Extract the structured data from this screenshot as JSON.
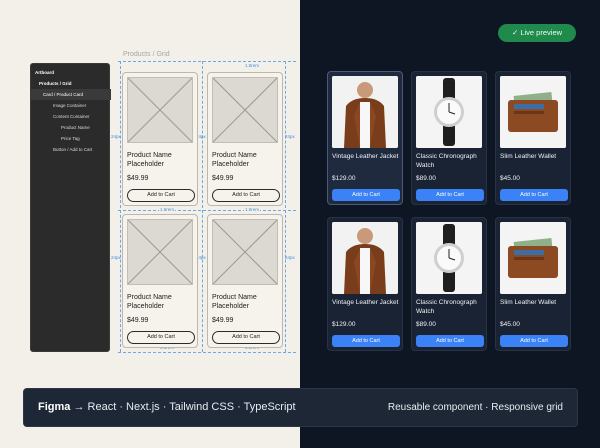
{
  "layers": {
    "items": [
      {
        "label": "Artboard",
        "bold": true,
        "indent": 0
      },
      {
        "label": "Products / Grid",
        "bold": true,
        "indent": 4
      },
      {
        "label": "Card / Product Card",
        "selected": true,
        "indent": 8
      },
      {
        "label": "Image Container",
        "indent": 22
      },
      {
        "label": "Content Container",
        "indent": 22
      },
      {
        "label": "Product Name",
        "indent": 30
      },
      {
        "label": "Price Tag",
        "indent": 30
      },
      {
        "label": "Button / Add to Cart",
        "indent": 22
      }
    ]
  },
  "wireframe": {
    "title": "Products / Grid",
    "product_name": "Product Name Placeholder",
    "price": "$49.99",
    "button": "Add to Cart",
    "spacing_label": "1.5rem",
    "padding_label": "24px"
  },
  "preview": {
    "badge": "Live preview",
    "products": [
      {
        "name": "Vintage Leather Jacket",
        "price": "$129.00",
        "button": "Add to Cart",
        "image": "jacket"
      },
      {
        "name": "Classic Chronograph Watch",
        "price": "$89.00",
        "button": "Add to Cart",
        "image": "watch"
      },
      {
        "name": "Slim Leather Wallet",
        "price": "$45.00",
        "button": "Add to Cart",
        "image": "wallet"
      },
      {
        "name": "Vintage Leather Jacket",
        "price": "$129.00",
        "button": "Add to Cart",
        "image": "jacket"
      },
      {
        "name": "Classic Chronograph Watch",
        "price": "$89.00",
        "button": "Add to Cart",
        "image": "watch"
      },
      {
        "name": "Slim Leather Wallet",
        "price": "$45.00",
        "button": "Add to Cart",
        "image": "wallet"
      }
    ]
  },
  "footer": {
    "left_bold": "Figma",
    "arrow": "→",
    "left_rest": "React · Next.js · Tailwind CSS · TypeScript",
    "right": "Reusable component · Responsive grid"
  },
  "colors": {
    "accent": "#3b82f6",
    "badge": "#1f8a4c",
    "guide": "#6aa9e8"
  }
}
